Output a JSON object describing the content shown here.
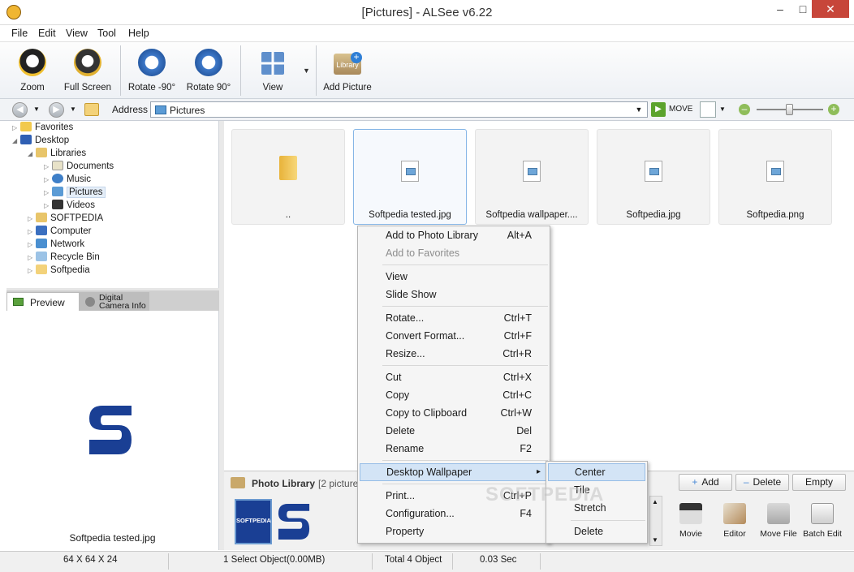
{
  "window": {
    "title": "[Pictures] - ALSee v6.22",
    "minimize": "–",
    "maximize": "□",
    "close": "✕"
  },
  "menu": [
    "File",
    "Edit",
    "View",
    "Tool",
    "Help"
  ],
  "toolbar": {
    "zoom": "Zoom",
    "full_screen": "Full Screen",
    "rotate_left": "Rotate -90°",
    "rotate_right": "Rotate 90°",
    "view": "View",
    "add_picture": "Add Picture",
    "library_badge": "Library"
  },
  "address": {
    "label": "Address",
    "value": "Pictures",
    "move": "MOVE"
  },
  "tree": [
    {
      "label": "Favorites"
    },
    {
      "label": "Desktop"
    },
    {
      "label": "Libraries"
    },
    {
      "label": "Documents"
    },
    {
      "label": "Music"
    },
    {
      "label": "Pictures"
    },
    {
      "label": "Videos"
    },
    {
      "label": "SOFTPEDIA"
    },
    {
      "label": "Computer"
    },
    {
      "label": "Network"
    },
    {
      "label": "Recycle Bin"
    },
    {
      "label": "Softpedia"
    }
  ],
  "preview": {
    "tab_preview": "Preview",
    "tab_camera_1": "Digital",
    "tab_camera_2": "Camera Info",
    "filename": "Softpedia tested.jpg"
  },
  "files": [
    {
      "name": ".."
    },
    {
      "name": "Softpedia tested.jpg"
    },
    {
      "name": "Softpedia wallpaper...."
    },
    {
      "name": "Softpedia.jpg"
    },
    {
      "name": "Softpedia.png"
    }
  ],
  "library": {
    "title": "Photo Library",
    "count": "[2 picture(",
    "add": "Add",
    "delete": "Delete",
    "empty": "Empty",
    "logo_text": "SOFTPEDIA",
    "tools": [
      "Movie",
      "Editor",
      "Move File",
      "Batch Edit"
    ]
  },
  "context_menu": [
    {
      "label": "Add to Photo Library",
      "key": "Alt+A"
    },
    {
      "label": "Add to Favorites",
      "key": ""
    },
    {
      "label": "View",
      "key": ""
    },
    {
      "label": "Slide Show",
      "key": ""
    },
    {
      "label": "Rotate...",
      "key": "Ctrl+T"
    },
    {
      "label": "Convert Format...",
      "key": "Ctrl+F"
    },
    {
      "label": "Resize...",
      "key": "Ctrl+R"
    },
    {
      "label": "Cut",
      "key": "Ctrl+X"
    },
    {
      "label": "Copy",
      "key": "Ctrl+C"
    },
    {
      "label": "Copy to Clipboard",
      "key": "Ctrl+W"
    },
    {
      "label": "Delete",
      "key": "Del"
    },
    {
      "label": "Rename",
      "key": "F2"
    },
    {
      "label": "Desktop Wallpaper",
      "key": "▸"
    },
    {
      "label": "Print...",
      "key": "Ctrl+P"
    },
    {
      "label": "Configuration...",
      "key": "F4"
    },
    {
      "label": "Property",
      "key": ""
    }
  ],
  "submenu": [
    "Center",
    "Tile",
    "Stretch",
    "Delete"
  ],
  "status": {
    "dimensions": "64 X 64 X 24",
    "selection": "1 Select Object(0.00MB)",
    "total": "Total 4 Object",
    "time": "0.03 Sec"
  },
  "watermark": "SOFTPEDIA",
  "colors": {
    "accent": "#1a3f94",
    "highlight": "#d3e4f6"
  }
}
